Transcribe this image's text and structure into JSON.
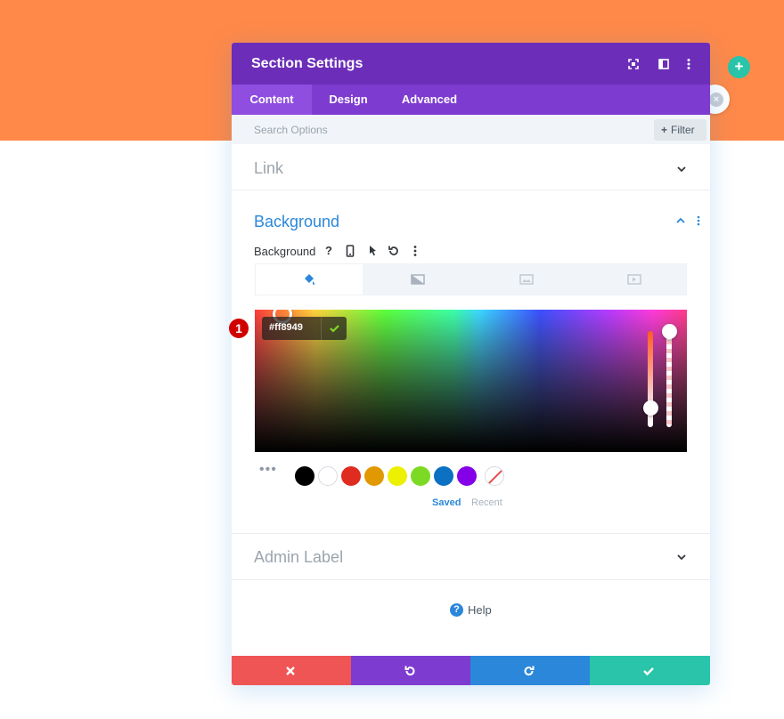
{
  "colors": {
    "banner": "#ff8949",
    "header": "#6c2eb9",
    "tabbar": "#7e3bd0",
    "accent_blue": "#2b87da",
    "teal": "#29c4a9",
    "badge_red": "#d00000",
    "discard": "#ef5555",
    "undo": "#7e3bd0",
    "redo": "#2b87da",
    "save": "#29c4a9"
  },
  "modal": {
    "title": "Section Settings",
    "header_icons": [
      "fullscreen-icon",
      "split-view-icon",
      "more-vertical-icon"
    ]
  },
  "tabs": [
    {
      "label": "Content",
      "active": true
    },
    {
      "label": "Design",
      "active": false
    },
    {
      "label": "Advanced",
      "active": false
    }
  ],
  "search": {
    "placeholder": "Search Options",
    "filter_label": "Filter"
  },
  "sections": {
    "link": {
      "title": "Link",
      "expanded": false
    },
    "background": {
      "title": "Background",
      "expanded": true
    },
    "admin_label": {
      "title": "Admin Label",
      "expanded": false
    }
  },
  "background_option": {
    "label": "Background",
    "option_icons": [
      "help-icon",
      "mobile-icon",
      "hover-cursor-icon",
      "reset-icon",
      "more-icon"
    ],
    "type_tabs": [
      "color-fill-icon",
      "gradient-icon",
      "image-icon",
      "video-icon"
    ],
    "active_type": 0
  },
  "color_picker": {
    "hex_value": "#ff8949",
    "hue_level": 0.2,
    "alpha_level": 1.0
  },
  "swatches": [
    "#000000",
    "#ffffff",
    "#e02b20",
    "#e09900",
    "#edf000",
    "#7cda24",
    "#0c71c3",
    "#8300e9"
  ],
  "palette_tabs": {
    "saved": "Saved",
    "recent": "Recent"
  },
  "help": {
    "label": "Help"
  },
  "annotation": {
    "step": "1"
  }
}
